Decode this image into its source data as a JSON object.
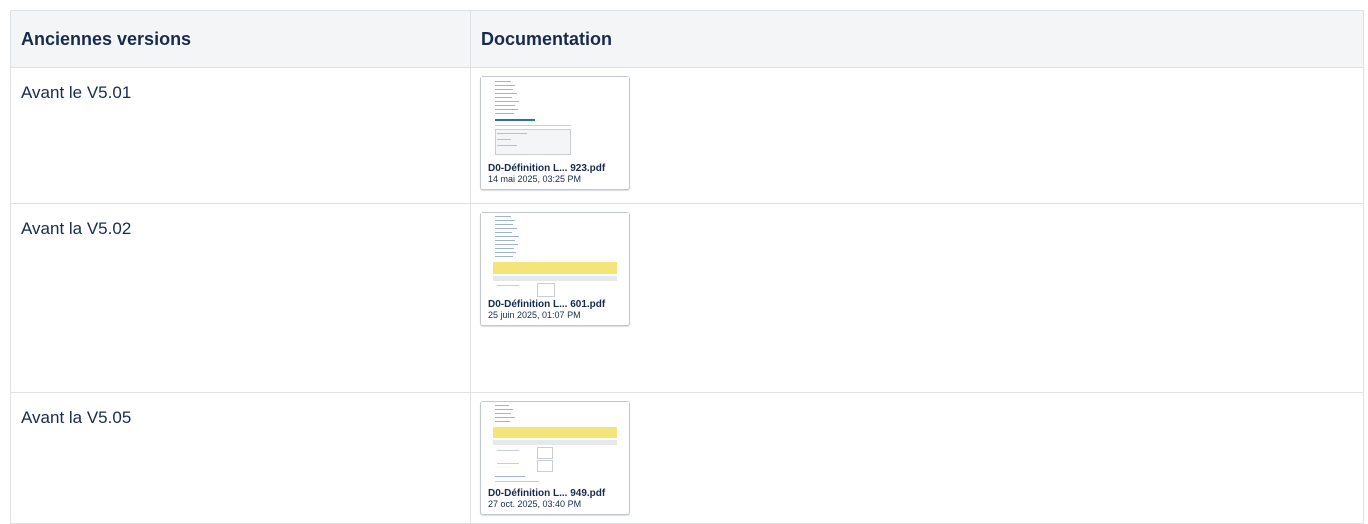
{
  "table": {
    "headers": {
      "versions": "Anciennes versions",
      "documentation": "Documentation"
    },
    "rows": [
      {
        "version": "Avant le V5.01",
        "file": {
          "name": "D0-Définition L... 923.pdf",
          "date": "14 mai 2025, 03:25 PM",
          "icon": "pdf-thumbnail-icon"
        }
      },
      {
        "version": "Avant la V5.02",
        "file": {
          "name": "D0-Définition L... 601.pdf",
          "date": "25 juin 2025, 01:07 PM",
          "icon": "pdf-thumbnail-icon"
        }
      },
      {
        "version": "Avant la V5.05",
        "file": {
          "name": "D0-Définition L... 949.pdf",
          "date": "27 oct. 2025, 03:40 PM",
          "icon": "pdf-thumbnail-icon"
        }
      }
    ]
  },
  "colors": {
    "header_bg": "#f4f5f7",
    "border": "#dfe1e6",
    "text": "#172b4d",
    "highlight": "#f5e47a"
  }
}
